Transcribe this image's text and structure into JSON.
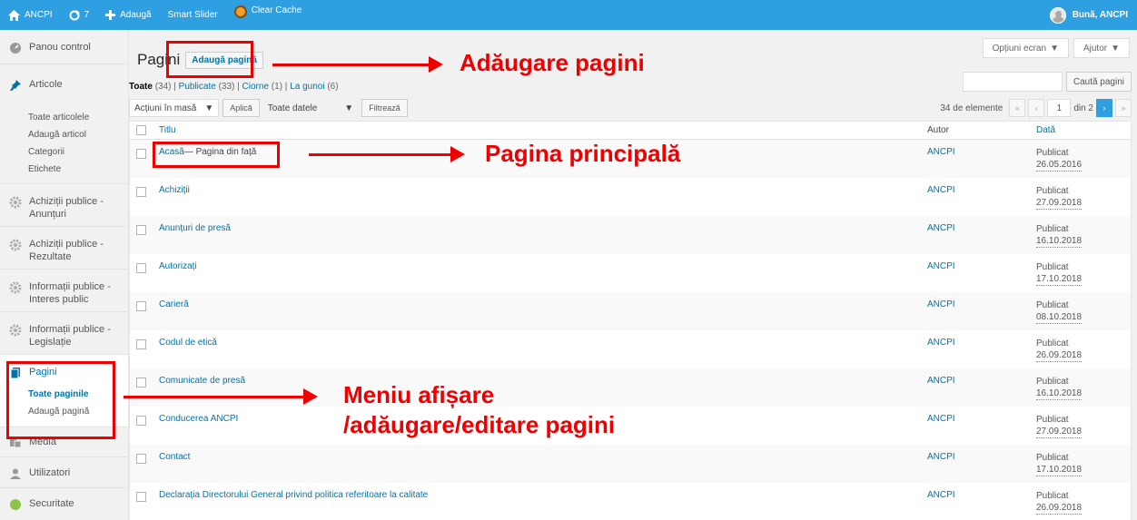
{
  "adminbar": {
    "site_name": "ANCPI",
    "updates_count": "7",
    "add_new": "Adaugă",
    "smart_slider": "Smart Slider",
    "clear_cache": "Clear Cache",
    "greeting": "Bună, ANCPI",
    "color": "#2e9fe0"
  },
  "sidebar": {
    "items": [
      {
        "label": "Panou control",
        "icon": "dashboard-icon"
      },
      {
        "label": "Articole",
        "icon": "pin-icon"
      },
      {
        "label": "Achiziții publice - Anunțuri",
        "icon": "gear-icon"
      },
      {
        "label": "Achiziții publice - Rezultate",
        "icon": "gear-icon"
      },
      {
        "label": "Informații publice - Interes public",
        "icon": "gear-icon"
      },
      {
        "label": "Informații publice - Legislație",
        "icon": "gear-icon"
      },
      {
        "label": "Pagini",
        "icon": "pages-icon"
      },
      {
        "label": "Media",
        "icon": "media-icon"
      },
      {
        "label": "Utilizatori",
        "icon": "user-icon"
      },
      {
        "label": "Securitate",
        "icon": "shield-icon"
      }
    ],
    "articole_sub": [
      "Toate articolele",
      "Adaugă articol",
      "Categorii",
      "Etichete"
    ],
    "pagini_sub": [
      "Toate paginile",
      "Adaugă pagină"
    ]
  },
  "main": {
    "screen_options": "Opțiuni ecran",
    "help": "Ajutor",
    "title": "Pagini",
    "add_page": "Adaugă pagină",
    "filters": {
      "all": "Toate",
      "all_count": "(34)",
      "published": "Publicate",
      "published_count": "(33)",
      "drafts": "Ciorne",
      "drafts_count": "(1)",
      "trash": "La gunoi",
      "trash_count": "(6)"
    },
    "search_button": "Caută pagini",
    "bulk_actions": "Acțiuni în masă",
    "apply": "Aplică",
    "all_dates": "Toate datele",
    "filter": "Filtrează",
    "items_count": "34 de elemente",
    "current_page": "1",
    "total_pages": "din 2",
    "columns": {
      "title": "Titlu",
      "author": "Autor",
      "date": "Dată"
    },
    "rows": [
      {
        "title": "Acasă",
        "state": " — Pagina din față",
        "author": "ANCPI",
        "status": "Publicat",
        "date": "26.05.2016"
      },
      {
        "title": "Achiziții",
        "state": "",
        "author": "ANCPI",
        "status": "Publicat",
        "date": "27.09.2018"
      },
      {
        "title": "Anunțuri de presă",
        "state": "",
        "author": "ANCPI",
        "status": "Publicat",
        "date": "16.10.2018"
      },
      {
        "title": "Autorizați",
        "state": "",
        "author": "ANCPI",
        "status": "Publicat",
        "date": "17.10.2018"
      },
      {
        "title": "Carieră",
        "state": "",
        "author": "ANCPI",
        "status": "Publicat",
        "date": "08.10.2018"
      },
      {
        "title": "Codul de etică",
        "state": "",
        "author": "ANCPI",
        "status": "Publicat",
        "date": "26.09.2018"
      },
      {
        "title": "Comunicate de presă",
        "state": "",
        "author": "ANCPI",
        "status": "Publicat",
        "date": "16.10.2018"
      },
      {
        "title": "Conducerea ANCPI",
        "state": "",
        "author": "ANCPI",
        "status": "Publicat",
        "date": "27.09.2018"
      },
      {
        "title": "Contact",
        "state": "",
        "author": "ANCPI",
        "status": "Publicat",
        "date": "17.10.2018"
      },
      {
        "title": "Declarația Directorului General privind politica referitoare la calitate",
        "state": "",
        "author": "ANCPI",
        "status": "Publicat",
        "date": "26.09.2018"
      }
    ]
  },
  "annotations": {
    "add_pages": "Adăugare pagini",
    "main_page": "Pagina principală",
    "menu_line1": "Meniu afișare",
    "menu_line2": "/adăugare/editare pagini",
    "color": "#e00000"
  }
}
